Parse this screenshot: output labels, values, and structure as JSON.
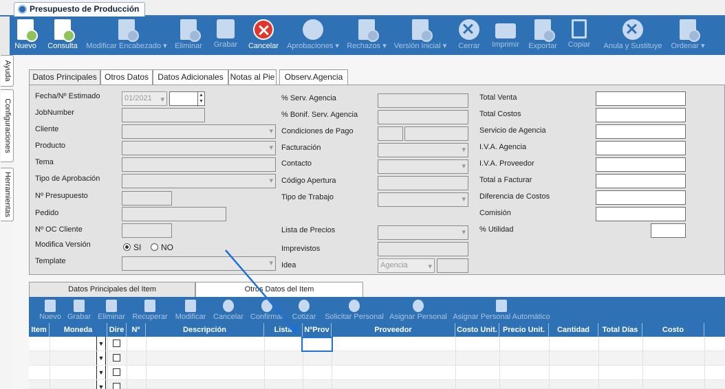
{
  "window_tab": {
    "title": "Presupuesto de Producción"
  },
  "toolbar": [
    {
      "label": "Nuevo",
      "icon": "new-doc-icon",
      "enabled": true
    },
    {
      "label": "Consulta",
      "icon": "query-doc-icon",
      "enabled": true
    },
    {
      "label": "Modificar Encabezado ▾",
      "icon": "edit-icon",
      "enabled": false
    },
    {
      "label": "Eliminar",
      "icon": "delete-doc-icon",
      "enabled": false
    },
    {
      "label": "Grabar",
      "icon": "floppy-icon",
      "enabled": false
    },
    {
      "label": "Cancelar",
      "icon": "cancel-icon",
      "enabled": true
    },
    {
      "label": "Aprobaciones ▾",
      "icon": "approve-icon",
      "enabled": false
    },
    {
      "label": "Rechazos ▾",
      "icon": "reject-icon",
      "enabled": false
    },
    {
      "label": "Versión Inicial ▾",
      "icon": "version-icon",
      "enabled": false
    },
    {
      "label": "Cerrar",
      "icon": "close-icon",
      "enabled": false
    },
    {
      "label": "Imprimir",
      "icon": "printer-icon",
      "enabled": false
    },
    {
      "label": "Exportar",
      "icon": "export-icon",
      "enabled": false
    },
    {
      "label": "Copiar",
      "icon": "copy-icon",
      "enabled": false
    },
    {
      "label": "Anula y Sustituye",
      "icon": "void-icon",
      "enabled": false
    },
    {
      "label": "Ordenar ▾",
      "icon": "order-icon",
      "enabled": false
    }
  ],
  "side_tabs": [
    "Ayuda",
    "Configuraciones",
    "Herramientas"
  ],
  "panel_tabs": [
    "Datos Principales",
    "Otros Datos",
    "Datos Adicionales",
    "Notas al Pie",
    "Observ.Agencia"
  ],
  "form": {
    "col1": {
      "fecha_label": "Fecha/Nº Estimado",
      "fecha_value": "01/2021",
      "jobnumber_label": "JobNumber",
      "cliente_label": "Cliente",
      "producto_label": "Producto",
      "tema_label": "Tema",
      "tipo_aprob_label": "Tipo de Aprobación",
      "n_presupuesto_label": "Nº Presupuesto",
      "pedido_label": "Pedido",
      "n_oc_label": "Nº OC Cliente",
      "modifica_label": "Modifica Versión",
      "si_label": "SI",
      "no_label": "NO",
      "template_label": "Template"
    },
    "col2": {
      "serv_agencia_label": "% Serv. Agencia",
      "bonif_label": "% Bonif. Serv. Agencia",
      "condiciones_label": "Condiciones de Pago",
      "facturacion_label": "Facturación",
      "contacto_label": "Contacto",
      "codigo_label": "Código Apertura",
      "tipo_trabajo_label": "Tipo de Trabajo",
      "lista_precios_label": "Lista de Precios",
      "imprevistos_label": "Imprevistos",
      "idea_label": "Idea",
      "idea_value": "Agencia"
    },
    "col3": {
      "total_venta_label": "Total Venta",
      "total_costos_label": "Total Costos",
      "servicio_label": "Servicio de Agencia",
      "iva_agencia_label": "I.V.A. Agencia",
      "iva_proveedor_label": "I.V.A. Proveedor",
      "total_facturar_label": "Total a Facturar",
      "diferencia_label": "Diferencia de Costos",
      "comision_label": "Comisión",
      "utilidad_label": "% Utilidad"
    }
  },
  "item_tabs": [
    "Datos Principales del Item",
    "Otros Datos del Item"
  ],
  "item_toolbar": [
    "Nuevo",
    "Grabar",
    "Eliminar",
    "Recuperar",
    "Modificar",
    "Cancelar",
    "Confirmar",
    "Cotizar",
    "Solicitar Personal",
    "Asignar Personal",
    "Asignar Personal Automático"
  ],
  "grid_headers": [
    "Item",
    "Moneda",
    "Dire",
    "Nº",
    "Descripción",
    "Lista",
    "NºProv",
    "Proveedor",
    "Costo Unit.",
    "Precio Unit.",
    "Cantidad",
    "Total Días",
    "Costo"
  ],
  "colors": {
    "accent": "#2f71b5",
    "focus": "#1a72d8",
    "cancel": "#e2362a"
  }
}
